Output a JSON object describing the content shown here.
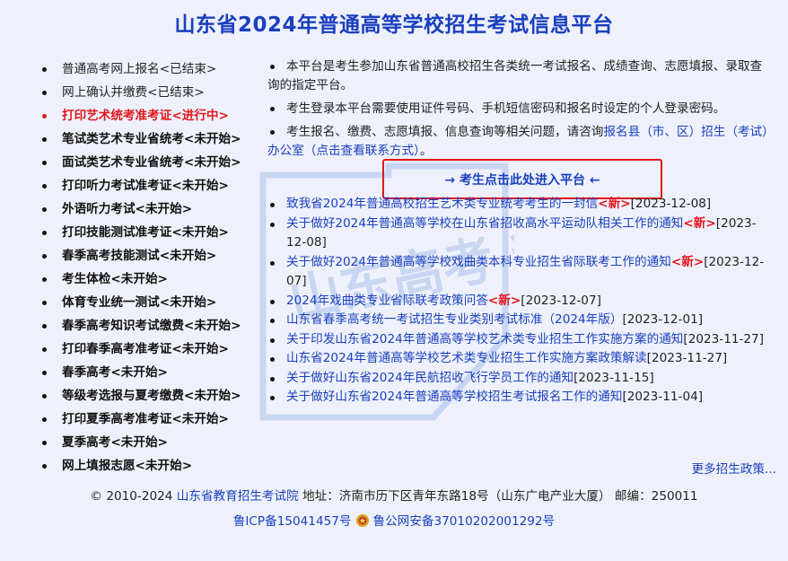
{
  "page": {
    "title": "山东省2024年普通高等学校招生考试信息平台"
  },
  "left_menu": [
    {
      "label": "普通高考网上报名<已结束>",
      "style": "normal"
    },
    {
      "label": "网上确认并缴费<已结束>",
      "style": "normal"
    },
    {
      "label": "打印艺术统考准考证<进行中>",
      "style": "active"
    },
    {
      "label": "笔试类艺术专业省统考<未开始>",
      "style": "bold"
    },
    {
      "label": "面试类艺术专业省统考<未开始>",
      "style": "bold"
    },
    {
      "label": "打印听力考试准考证<未开始>",
      "style": "bold"
    },
    {
      "label": "外语听力考试<未开始>",
      "style": "bold"
    },
    {
      "label": "打印技能测试准考证<未开始>",
      "style": "bold"
    },
    {
      "label": "春季高考技能测试<未开始>",
      "style": "bold"
    },
    {
      "label": "考生体检<未开始>",
      "style": "bold"
    },
    {
      "label": "体育专业统一测试<未开始>",
      "style": "bold"
    },
    {
      "label": "春季高考知识考试缴费<未开始>",
      "style": "bold"
    },
    {
      "label": "打印春季高考准考证<未开始>",
      "style": "bold"
    },
    {
      "label": "春季高考<未开始>",
      "style": "bold"
    },
    {
      "label": "等级考选报与夏考缴费<未开始>",
      "style": "bold"
    },
    {
      "label": "打印夏季高考准考证<未开始>",
      "style": "bold"
    },
    {
      "label": "夏季高考<未开始>",
      "style": "bold"
    },
    {
      "label": "网上填报志愿<未开始>",
      "style": "bold"
    }
  ],
  "intro": {
    "line1": "本平台是考生参加山东省普通高校招生各类统一考试报名、成绩查询、志愿填报、录取查询的指定平台。",
    "line2": "考生登录本平台需要使用证件号码、手机短信密码和报名时设定的个人登录密码。",
    "line3_prefix": "考生报名、缴费、志愿填报、信息查询等相关问题，请咨询",
    "line3_link": "报名县（市、区）招生（考试）办公室（点击查看联系方式）",
    "line3_suffix": "。"
  },
  "enter_button": {
    "label": "→ 考生点击此处进入平台 ←"
  },
  "news": [
    {
      "title": "致我省2024年普通高校招生艺术类专业统考考生的一封信",
      "new": "<新>",
      "date": "[2023-12-08]"
    },
    {
      "title": "关于做好2024年普通高等学校在山东省招收高水平运动队相关工作的通知",
      "new": "<新>",
      "date": "[2023-12-08]"
    },
    {
      "title": "关于做好2024年普通高等学校戏曲类本科专业招生省际联考工作的通知",
      "new": "<新>",
      "date": "[2023-12-07]"
    },
    {
      "title": "2024年戏曲类专业省际联考政策问答",
      "new": "<新>",
      "date": "[2023-12-07]"
    },
    {
      "title": "山东省春季高考统一考试招生专业类别考试标准（2024年版）",
      "new": "",
      "date": "[2023-12-01]"
    },
    {
      "title": "关于印发山东省2024年普通高等学校艺术类专业招生工作实施方案的通知",
      "new": "",
      "date": "[2023-11-27]"
    },
    {
      "title": "山东省2024年普通高等学校艺术类专业招生工作实施方案政策解读",
      "new": "",
      "date": "[2023-11-27]"
    },
    {
      "title": "关于做好山东省2024年民航招收飞行学员工作的通知",
      "new": "",
      "date": "[2023-11-15]"
    },
    {
      "title": "关于做好山东省2024年普通高等学校招生考试报名工作的通知",
      "new": "",
      "date": "[2023-11-04]"
    }
  ],
  "more_link": "更多招生政策...",
  "footer": {
    "copyright_prefix": "© 2010-2024 ",
    "org_link": "山东省教育招生考试院",
    "address": " 地址：济南市历下区青年东路18号（山东广电产业大厦） 邮编：250011",
    "icp": "鲁ICP备15041457号",
    "police": "鲁公网安备37010202001292号",
    "police_icon": "police-badge-icon"
  },
  "watermark": {
    "text": "山东高考 升学宝"
  },
  "colors": {
    "accent_blue": "#1a3fbf",
    "alert_red": "#e4161b",
    "background": "#eef1fb"
  }
}
